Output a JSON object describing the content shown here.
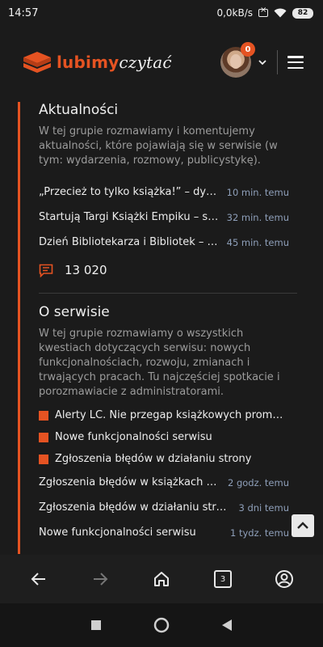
{
  "status": {
    "time": "14:57",
    "speed": "0,0kB/s",
    "battery": "82"
  },
  "header": {
    "logo_part1": "lubimy",
    "logo_part2": "czytać",
    "notification_count": "0"
  },
  "sections": [
    {
      "title": "Aktualności",
      "description": "W tej grupie rozmawiamy i komentujemy aktualności, które pojawiają się w serwisie (w tym: wydarzenia, rozmowy, publicystykę).",
      "topics": [
        {
          "title": "„Przecież to tylko książka!” – dyskusja",
          "time": "10 min. temu"
        },
        {
          "title": "Startują Targi Książki Empiku – sprawdź",
          "time": "32 min. temu"
        },
        {
          "title": "Dzień Bibliotekarza i Bibliotek – świętuj",
          "time": "45 min. temu"
        }
      ],
      "count": "13 020"
    },
    {
      "title": "O serwisie",
      "description": "W tej grupie rozmawiamy o wszystkich kwestiach dotyczących serwisu: nowych funkcjonalnościach, rozwoju, zmianach i trwających pracach. Tu najczęściej spotkacie i porozmawiacie z administratorami.",
      "pinned": [
        {
          "title": "Alerty LC. Nie przegap książkowych promocji"
        },
        {
          "title": "Nowe funkcjonalności serwisu"
        },
        {
          "title": "Zgłoszenia błędów w działaniu strony"
        }
      ],
      "topics": [
        {
          "title": "Zgłoszenia błędów w książkach i autorach",
          "time": "2 godz. temu"
        },
        {
          "title": "Zgłoszenia błędów w działaniu strony",
          "time": "3 dni temu"
        },
        {
          "title": "Nowe funkcjonalności serwisu",
          "time": "1 tydz. temu"
        }
      ]
    }
  ],
  "browser": {
    "tab_count": "3"
  },
  "colors": {
    "accent": "#e55322",
    "background": "#1b1b1b",
    "time_text": "#8e9fb9"
  }
}
